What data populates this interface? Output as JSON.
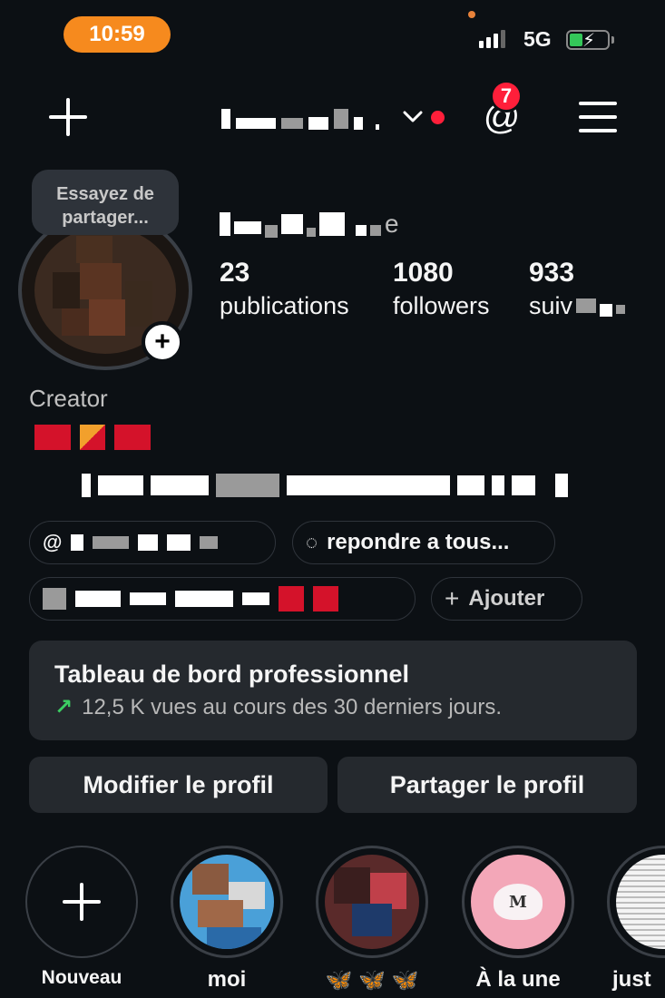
{
  "status_bar": {
    "time": "10:59",
    "network": "5G"
  },
  "header": {
    "notification_count": "7"
  },
  "profile": {
    "tooltip": "Essayez de partager...",
    "display_name_suffix": "e",
    "stats": [
      {
        "value": "23",
        "label": "publications"
      },
      {
        "value": "1080",
        "label": "followers"
      },
      {
        "value": "933",
        "label": "suiv"
      }
    ],
    "category": "Creator"
  },
  "chips": {
    "reply_all": "repondre a tous...",
    "add": "Ajouter"
  },
  "dashboard": {
    "title": "Tableau de bord professionnel",
    "subtitle": "12,5 K vues au cours des 30 derniers jours."
  },
  "buttons": {
    "edit": "Modifier le profil",
    "share": "Partager le profil"
  },
  "highlights": [
    {
      "label": "Nouveau"
    },
    {
      "label": "moi"
    },
    {
      "label": "🦋 🦋 🦋"
    },
    {
      "label": "À la une"
    },
    {
      "label": "just"
    }
  ],
  "colors": {
    "background": "#0c1014",
    "time_pill": "#f68a1e",
    "badge": "#ff1f3a",
    "card": "#25292e",
    "trend_arrow": "#3ccf63"
  },
  "icons": [
    "plus-icon",
    "chevron-down-icon",
    "threads-icon",
    "menu-icon",
    "threads-link-icon",
    "reply-icon",
    "trend-up-icon"
  ]
}
